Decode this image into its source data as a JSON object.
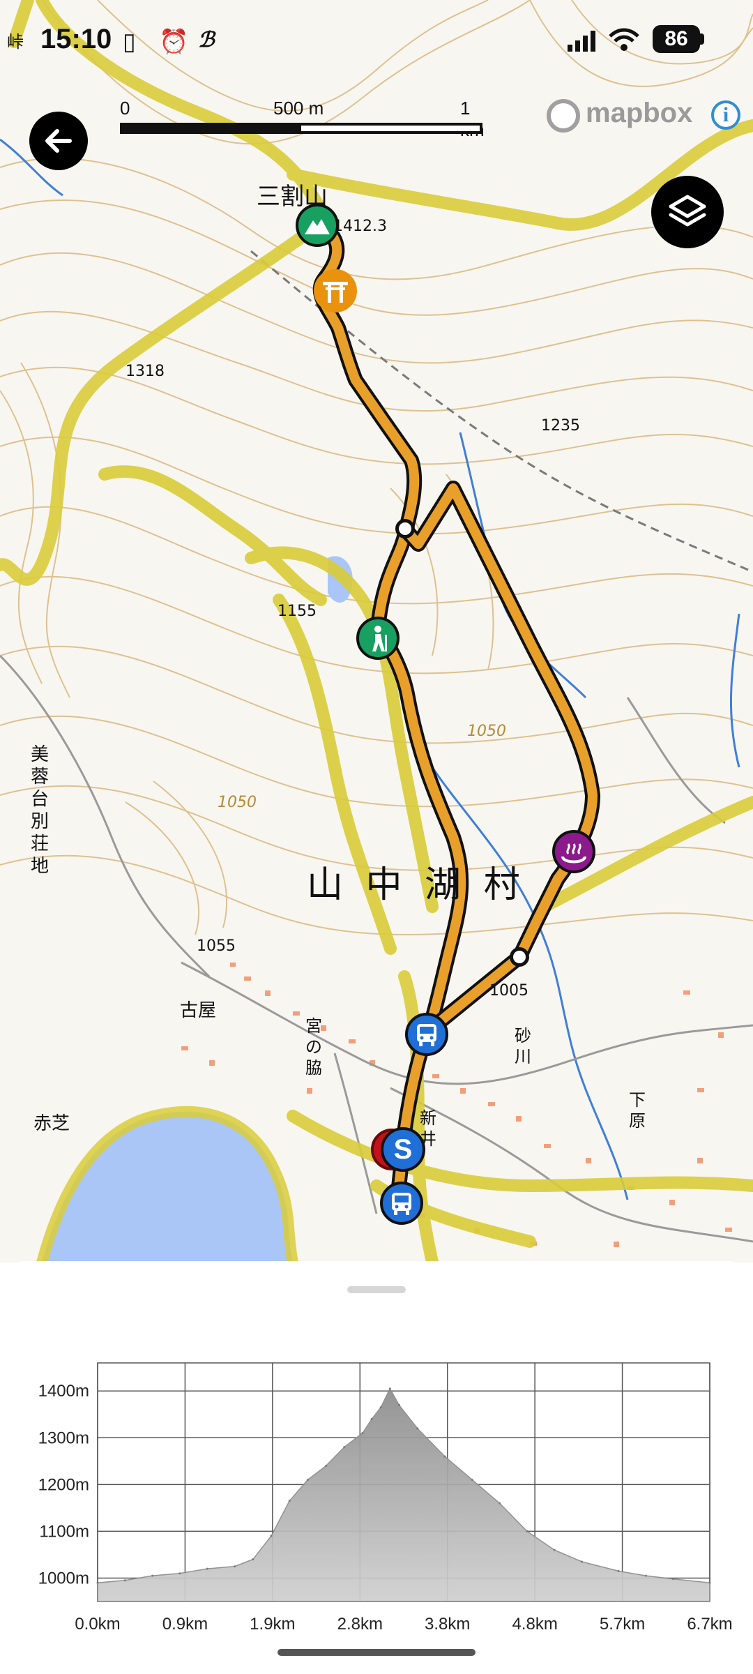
{
  "status_bar": {
    "time": "15:10",
    "battery": "86",
    "icons": [
      "sim-card-icon",
      "alarm-icon",
      "app-notification-icon",
      "signal-icon",
      "wifi-icon",
      "battery-icon"
    ]
  },
  "map": {
    "scale": {
      "labels": [
        "0",
        "500 m",
        "1 km"
      ]
    },
    "attribution": "mapbox",
    "buttons": {
      "back": "back-arrow-icon",
      "layers": "layers-icon",
      "info": "i"
    },
    "labels": {
      "village": "山 中 湖 村",
      "peak_name": "三割山",
      "elev_1412": "1412.3",
      "elev_1235": "1235",
      "elev_1318": "1318",
      "elev_1155": "1155",
      "elev_1050a": "1050",
      "elev_1050b": "1050",
      "elev_1055": "1055",
      "elev_1005": "1005",
      "area_left": "美蓉台別荘地",
      "area_koya": "古屋",
      "area_miyanowaki": "宮の脇",
      "area_arai": "新井",
      "area_akashiba": "赤芝",
      "area_shimohara": "下原",
      "area_sunagawa": "砂川",
      "corner": "峠"
    },
    "markers": [
      "peak-marker",
      "shrine-marker",
      "hiker-marker",
      "onsen-marker",
      "bus-stop-marker",
      "start-marker",
      "end-marker",
      "bus-stop-marker"
    ],
    "route_color": "#e9a02a",
    "road_color": "#d9cc3a",
    "lake_color": "#a9c6f7"
  },
  "elevation_chart": {
    "chart_data": {
      "type": "area",
      "title": "",
      "xlabel": "",
      "ylabel": "",
      "x_tick_labels": [
        "0.0km",
        "0.9km",
        "1.9km",
        "2.8km",
        "3.8km",
        "4.8km",
        "5.7km",
        "6.7km"
      ],
      "y_tick_labels": [
        "1000m",
        "1100m",
        "1200m",
        "1300m",
        "1400m"
      ],
      "xlim": [
        0,
        6.7
      ],
      "ylim": [
        950,
        1460
      ],
      "grid": true,
      "x": [
        0.0,
        0.3,
        0.6,
        0.9,
        1.2,
        1.5,
        1.7,
        1.9,
        2.1,
        2.3,
        2.5,
        2.7,
        2.9,
        3.0,
        3.1,
        3.2,
        3.3,
        3.5,
        3.8,
        4.1,
        4.4,
        4.7,
        5.0,
        5.3,
        5.7,
        6.0,
        6.3,
        6.7
      ],
      "values": [
        990,
        995,
        1005,
        1010,
        1020,
        1025,
        1040,
        1090,
        1165,
        1210,
        1240,
        1280,
        1310,
        1340,
        1365,
        1405,
        1370,
        1320,
        1260,
        1210,
        1160,
        1100,
        1060,
        1035,
        1015,
        1005,
        998,
        990
      ]
    }
  }
}
